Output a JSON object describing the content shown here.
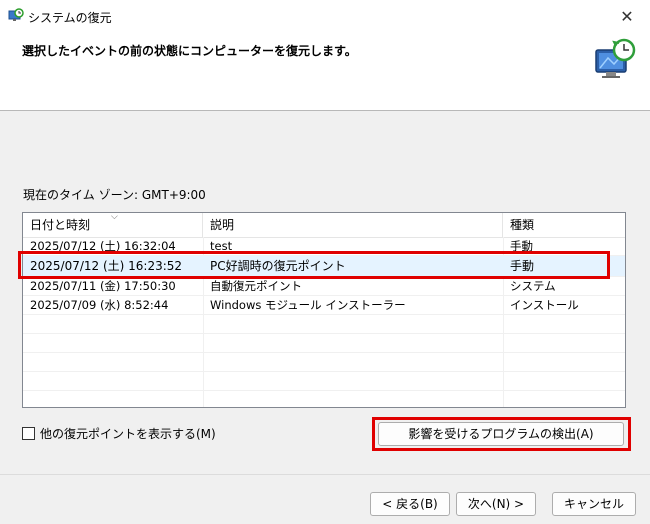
{
  "window": {
    "title": "システムの復元",
    "close_label": "✕"
  },
  "header": {
    "instruction": "選択したイベントの前の状態にコンピューターを復元します。"
  },
  "timezone_label": "現在のタイム ゾーン: GMT+9:00",
  "table": {
    "columns": [
      "日付と時刻",
      "説明",
      "種類"
    ],
    "sort_glyph": "⌵",
    "rows": [
      {
        "date": "2025/07/12 (土) 16:32:04",
        "description": "test",
        "type": "手動"
      },
      {
        "date": "2025/07/12 (土) 16:23:52",
        "description": "PC好調時の復元ポイント",
        "type": "手動"
      },
      {
        "date": "2025/07/11 (金) 17:50:30",
        "description": "自動復元ポイント",
        "type": "システム"
      },
      {
        "date": "2025/07/09 (水) 8:52:44",
        "description": "Windows モジュール インストーラー",
        "type": "インストール"
      }
    ]
  },
  "show_more_label": "他の復元ポイントを表示する(M)",
  "buttons": {
    "detect": "影響を受けるプログラムの検出(A)",
    "back": "< 戻る(B)",
    "next": "次へ(N) >",
    "cancel": "キャンセル"
  },
  "colors": {
    "highlight": "#e00000",
    "selected_row": "#e5f3ff"
  }
}
